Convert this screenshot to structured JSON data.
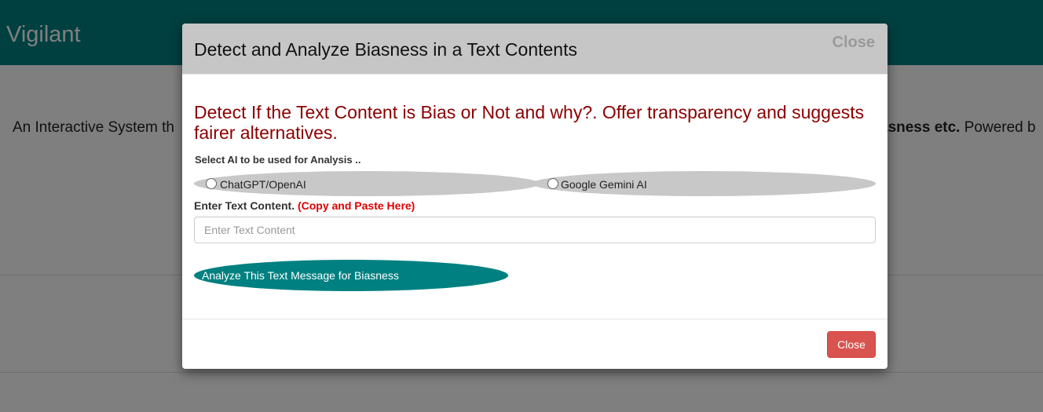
{
  "navbar": {
    "brand": "Vigilant"
  },
  "background": {
    "intro_left": "An Interactive System th",
    "intro_right_bold": "asness etc.",
    "intro_right_rest": " Powered b"
  },
  "modal": {
    "title": "Detect and Analyze Biasness in a Text Contents",
    "header_close": "Close",
    "lead": "Detect If the Text Content is Bias or Not and why?. Offer transparency and suggests fairer alternatives.",
    "select_label": "Select AI to be used for Analysis ..",
    "options": [
      {
        "label": "ChatGPT/OpenAI"
      },
      {
        "label": "Google Gemini AI"
      }
    ],
    "content_label": "Enter Text Content.",
    "content_hint": "(Copy and Paste Here)",
    "input_placeholder": "Enter Text Content",
    "input_value": "",
    "analyze_label": "Analyze This Text Message for Biasness",
    "footer_close": "Close"
  },
  "colors": {
    "brand": "#008080",
    "lead": "#8b0000",
    "hint": "#e00000",
    "danger": "#d9534f"
  }
}
